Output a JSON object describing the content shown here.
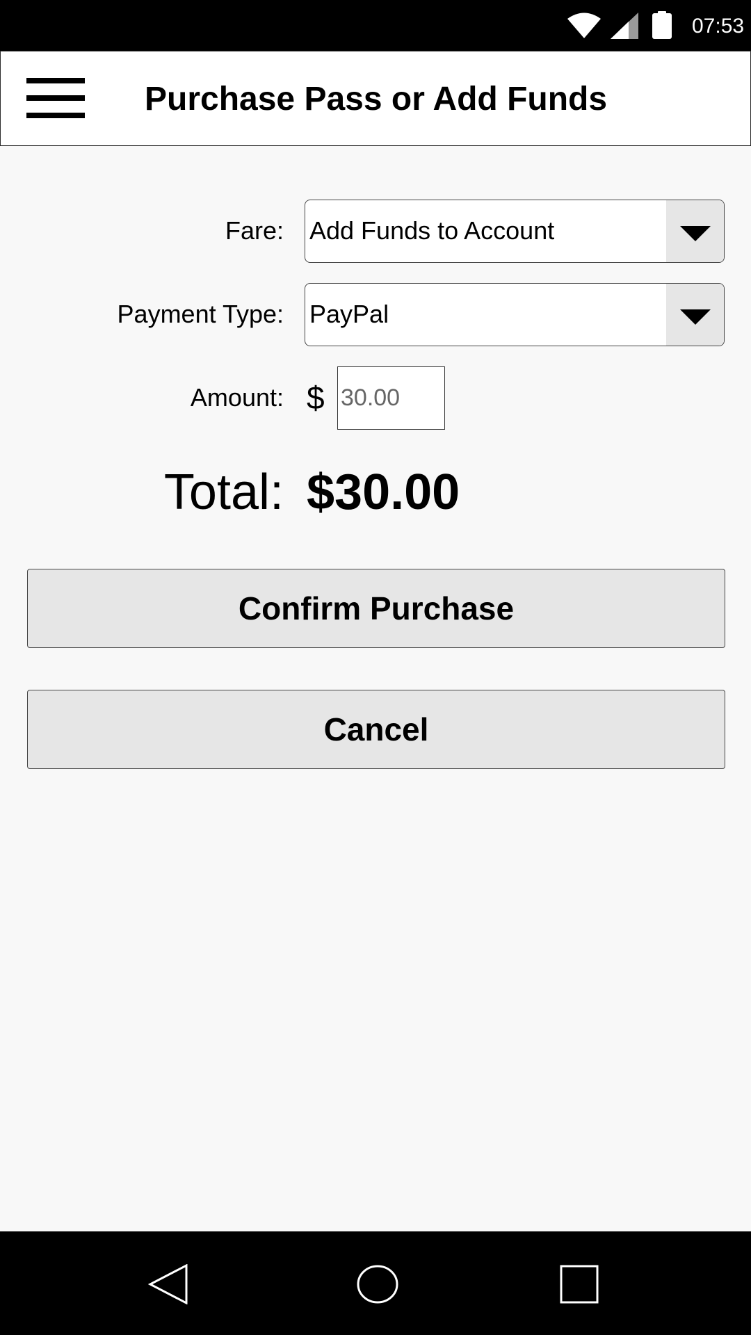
{
  "status_bar": {
    "time": "07:53",
    "icons": [
      "wifi-icon",
      "cellular-signal-icon",
      "battery-icon"
    ]
  },
  "app_bar": {
    "menu_icon": "hamburger-menu-icon",
    "title": "Purchase Pass or Add Funds"
  },
  "form": {
    "fare": {
      "label": "Fare:",
      "selected": "Add Funds to Account"
    },
    "payment_type": {
      "label": "Payment Type:",
      "selected": "PayPal"
    },
    "amount": {
      "label": "Amount:",
      "currency_symbol": "$",
      "placeholder": "30.00"
    },
    "total": {
      "label": "Total:",
      "value": "$30.00"
    }
  },
  "actions": {
    "confirm_label": "Confirm Purchase",
    "cancel_label": "Cancel"
  },
  "nav_bar": {
    "icons": [
      "back-icon",
      "home-icon",
      "recents-icon"
    ]
  },
  "colors": {
    "background": "#f8f8f8",
    "button_fill": "#e6e6e6",
    "system_bars": "#000000"
  }
}
